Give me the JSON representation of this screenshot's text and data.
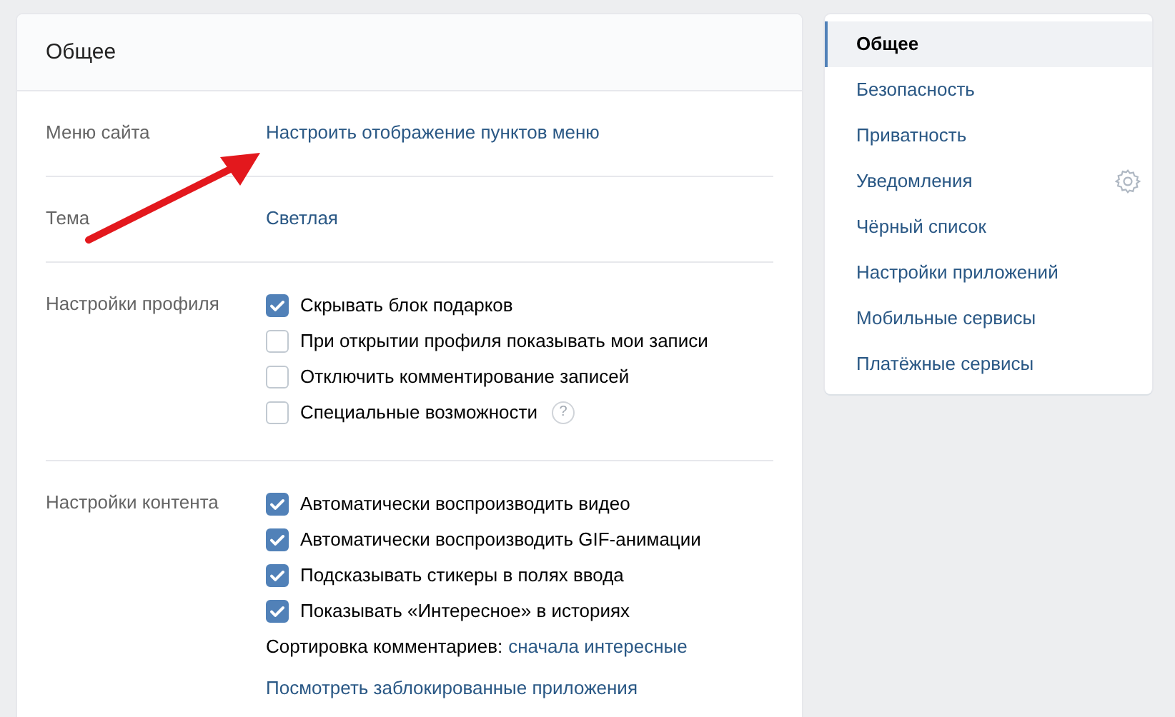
{
  "main": {
    "title": "Общее",
    "sections": [
      {
        "label": "Меню сайта",
        "kind": "link",
        "link": "Настроить отображение пунктов меню"
      },
      {
        "label": "Тема",
        "kind": "link",
        "link": "Светлая"
      },
      {
        "label": "Настройки профиля",
        "kind": "checkboxes",
        "options": [
          {
            "label": "Скрывать блок подарков",
            "checked": true
          },
          {
            "label": "При открытии профиля показывать мои записи",
            "checked": false
          },
          {
            "label": "Отключить комментирование записей",
            "checked": false
          },
          {
            "label": "Специальные возможности",
            "checked": false,
            "help": "?"
          }
        ]
      },
      {
        "label": "Настройки контента",
        "kind": "checkboxes",
        "options": [
          {
            "label": "Автоматически воспроизводить видео",
            "checked": true
          },
          {
            "label": "Автоматически воспроизводить GIF-анимации",
            "checked": true
          },
          {
            "label": "Подсказывать стикеры в полях ввода",
            "checked": true
          },
          {
            "label": "Показывать «Интересное» в историях",
            "checked": true
          }
        ],
        "sort": {
          "label": "Сортировка комментариев:",
          "value": "сначала интересные"
        },
        "link": "Посмотреть заблокированные приложения"
      }
    ]
  },
  "sidebar": {
    "items": [
      {
        "label": "Общее",
        "selected": true
      },
      {
        "label": "Безопасность",
        "selected": false
      },
      {
        "label": "Приватность",
        "selected": false
      },
      {
        "label": "Уведомления",
        "selected": false,
        "gear": true
      },
      {
        "label": "Чёрный список",
        "selected": false
      },
      {
        "label": "Настройки приложений",
        "selected": false
      },
      {
        "label": "Мобильные сервисы",
        "selected": false
      },
      {
        "label": "Платёжные сервисы",
        "selected": false
      }
    ]
  }
}
